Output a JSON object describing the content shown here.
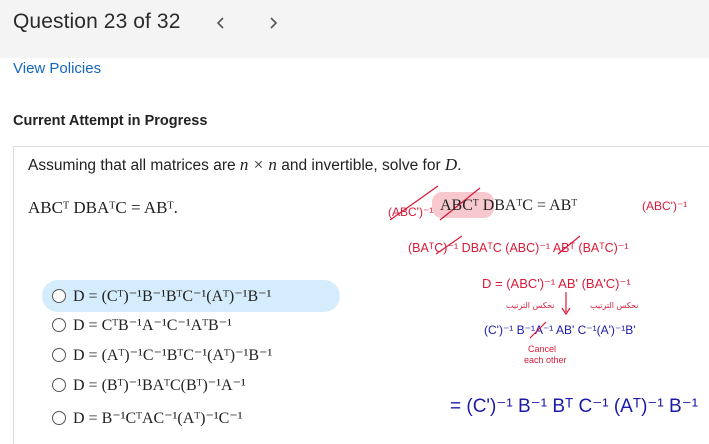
{
  "header": {
    "question_label": "Question 23 of 32",
    "prev_glyph": "<",
    "next_glyph": ">"
  },
  "links": {
    "view_policies": "View Policies"
  },
  "attempt": {
    "status": "Current Attempt in Progress"
  },
  "question": {
    "prompt_pre": "Assuming that all matrices are ",
    "prompt_math": "n × n",
    "prompt_post": " and invertible, solve for ",
    "prompt_var": "D",
    "prompt_end": ".",
    "equation": "ABCᵀ DBAᵀC = ABᵀ."
  },
  "options": [
    {
      "text": "D = (Cᵀ)⁻¹B⁻¹BᵀC⁻¹(Aᵀ)⁻¹B⁻¹",
      "selected": true
    },
    {
      "text": "D = CᵀB⁻¹A⁻¹C⁻¹AᵀB⁻¹",
      "selected": false
    },
    {
      "text": "D = (Aᵀ)⁻¹C⁻¹BᵀC⁻¹(Aᵀ)⁻¹B⁻¹",
      "selected": false
    },
    {
      "text": "D = (Bᵀ)⁻¹BAᵀC(Bᵀ)⁻¹A⁻¹",
      "selected": false
    },
    {
      "text": "D = B⁻¹CᵀAC⁻¹(Aᵀ)⁻¹C⁻¹",
      "selected": false
    }
  ],
  "annotations": {
    "line1_left": "(ABC')⁻¹",
    "line1_eq": "ABCᵀ DBAᵀC = ABᵀ",
    "line1_right": "(ABC')⁻¹",
    "line2": "(BAᵀC)⁻¹ DBAᵀC (ABC)⁻¹ ABᵀ (BAᵀC)⁻¹",
    "line3": "D = (ABC')⁻¹ AB' (BA'C)⁻¹",
    "arabic_left": "نحكس الترتيب",
    "arabic_right": "نحكس الترتيب",
    "line4": "(C')⁻¹ B⁻¹A⁻¹ AB' C⁻¹(A')⁻¹B'",
    "cancel_note_1": "Cancel",
    "cancel_note_2": "each other",
    "result": "= (C')⁻¹ B⁻¹ Bᵀ C⁻¹ (Aᵀ)⁻¹ B⁻¹",
    "ink_red": "#d81b3a",
    "ink_blue": "#1a1aa8",
    "highlight": "#f7c9cf"
  }
}
